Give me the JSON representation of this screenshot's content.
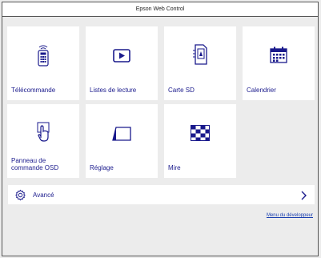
{
  "window": {
    "title": "Epson Web Control"
  },
  "tiles": [
    {
      "label": "Télécommande",
      "icon": "remote-icon"
    },
    {
      "label": "Listes de lecture",
      "icon": "play-icon"
    },
    {
      "label": "Carte SD",
      "icon": "sd-card-icon"
    },
    {
      "label": "Calendrier",
      "icon": "calendar-icon"
    },
    {
      "label": "Panneau de\ncommande OSD",
      "icon": "touch-hand-icon"
    },
    {
      "label": "Réglage",
      "icon": "keystone-icon"
    },
    {
      "label": "Mire",
      "icon": "test-pattern-icon"
    }
  ],
  "advanced": {
    "label": "Avancé"
  },
  "developer_link": "Menu du développeur",
  "colors": {
    "accent": "#1a1a8c",
    "background": "#ececec"
  }
}
